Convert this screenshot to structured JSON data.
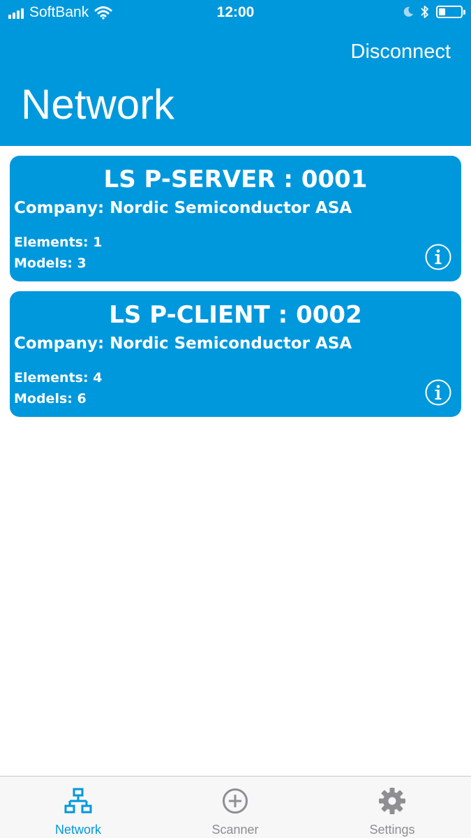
{
  "status_bar": {
    "carrier": "SoftBank",
    "time": "12:00",
    "battery_level": 0.3
  },
  "header": {
    "action_label": "Disconnect",
    "title": "Network"
  },
  "nodes": [
    {
      "title": "LS P-SERVER : 0001",
      "company": "Company: Nordic Semiconductor ASA",
      "elements": "Elements: 1",
      "models": "Models: 3"
    },
    {
      "title": "LS P-CLIENT : 0002",
      "company": "Company: Nordic Semiconductor ASA",
      "elements": "Elements: 4",
      "models": "Models: 6"
    }
  ],
  "tab_bar": {
    "tabs": [
      {
        "label": "Network",
        "icon": "network-icon",
        "active": true
      },
      {
        "label": "Scanner",
        "icon": "add-circle-icon",
        "active": false
      },
      {
        "label": "Settings",
        "icon": "gear-icon",
        "active": false
      }
    ]
  },
  "colors": {
    "accent": "#0098dc",
    "tab_inactive": "#8e8e93",
    "background": "#ffffff"
  }
}
